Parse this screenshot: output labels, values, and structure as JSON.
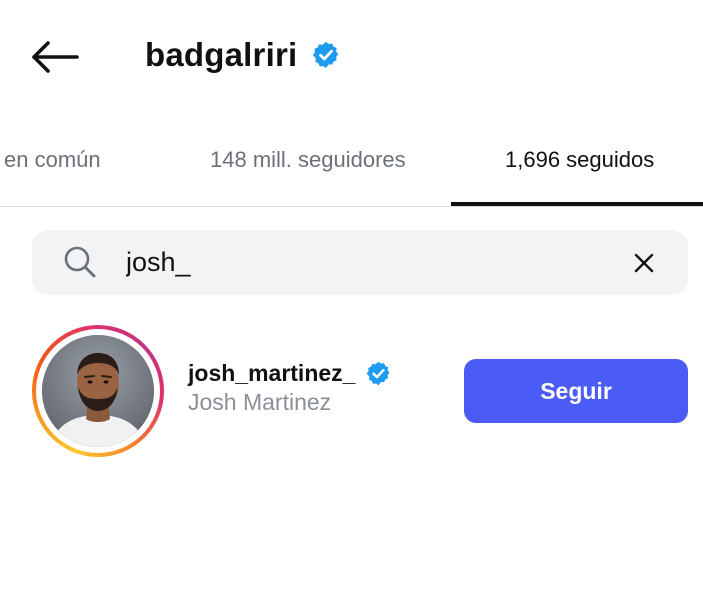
{
  "header": {
    "title": "badgalriri",
    "verified": true,
    "back_icon": "arrow-left-icon"
  },
  "tabs": [
    {
      "label": "en común",
      "active": false
    },
    {
      "label": "148 mill. seguidores",
      "active": false
    },
    {
      "label": "1,696 seguidos",
      "active": true
    }
  ],
  "search": {
    "value": "josh_",
    "icon": "search-icon",
    "clear_icon": "close-icon"
  },
  "results": [
    {
      "username": "josh_martinez_",
      "full_name": "Josh Martinez",
      "verified": true,
      "has_story_ring": true,
      "button_label": "Seguir"
    }
  ],
  "colors": {
    "accent": "#4a5cf5",
    "verified_badge": "#1d9bf0",
    "muted_text": "#8a8f98",
    "tab_inactive": "#6b7079"
  }
}
